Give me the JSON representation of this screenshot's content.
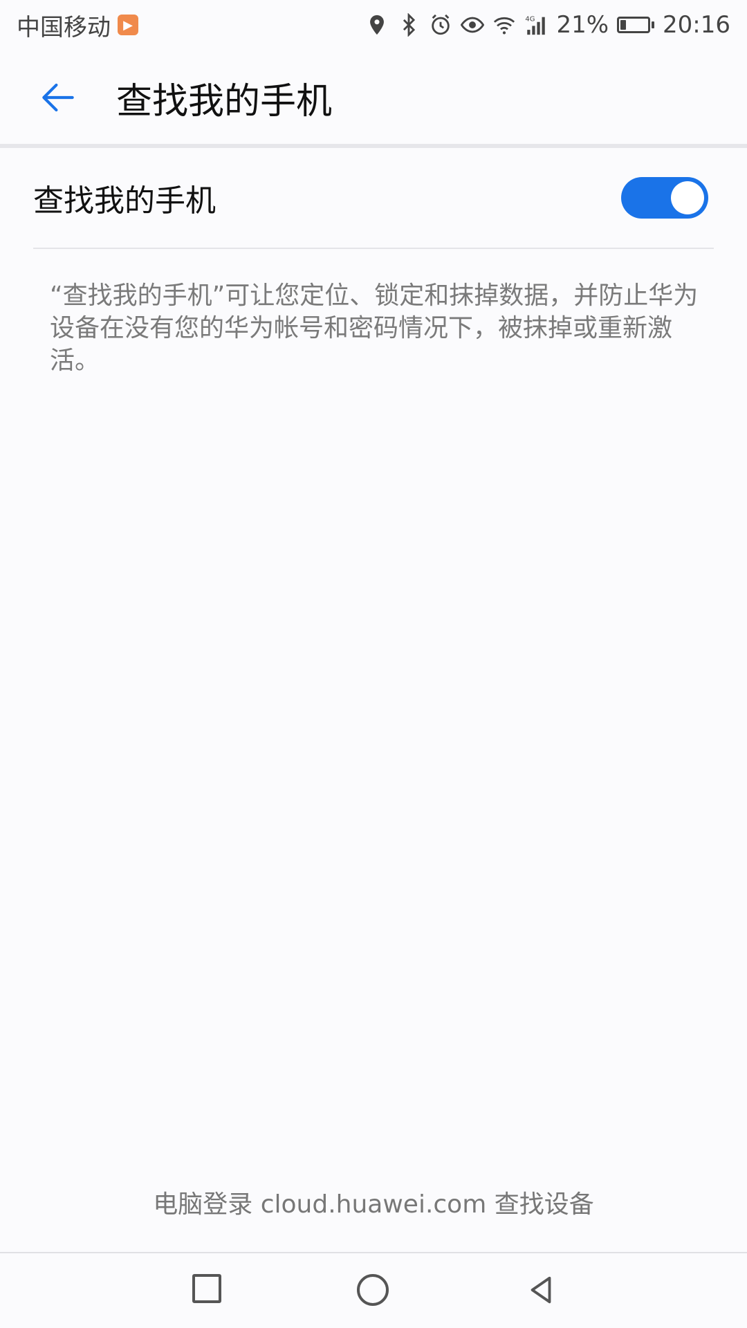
{
  "status_bar": {
    "carrier": "中国移动",
    "network": "4G",
    "battery_percent": "21%",
    "battery_level": 0.21,
    "time": "20:16",
    "icons": [
      "location-icon",
      "bluetooth-icon",
      "alarm-icon",
      "eye-icon",
      "wifi-icon",
      "signal-icon",
      "battery-icon"
    ]
  },
  "app_bar": {
    "title": "查找我的手机"
  },
  "setting": {
    "label": "查找我的手机",
    "enabled": true
  },
  "description": "“查找我的手机”可让您定位、锁定和抹掉数据，并防止华为设备在没有您的华为帐号和密码情况下，被抹掉或重新激活。",
  "footer": {
    "text": "电脑登录 cloud.huawei.com 查找设备"
  },
  "colors": {
    "accent": "#1a73e8",
    "background": "#fbfbfd",
    "secondary_text": "#7a7a7a"
  }
}
